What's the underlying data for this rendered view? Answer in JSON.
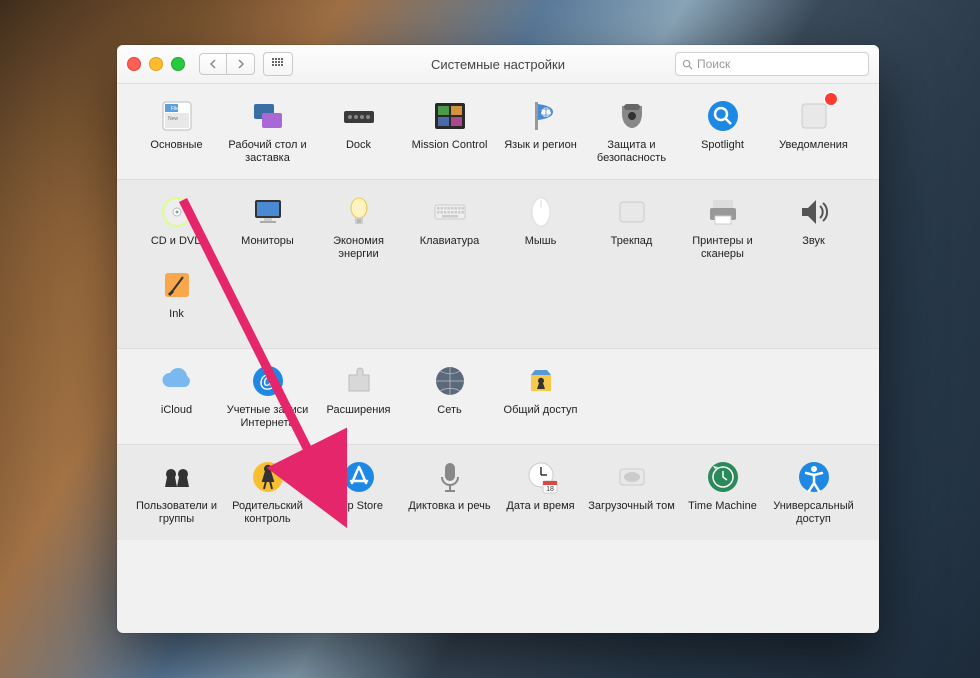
{
  "window": {
    "title": "Системные настройки",
    "search_placeholder": "Поиск"
  },
  "sections": [
    {
      "alt": false,
      "items": [
        {
          "id": "general",
          "label": "Основные"
        },
        {
          "id": "desktop",
          "label": "Рабочий стол и заставка"
        },
        {
          "id": "dock",
          "label": "Dock"
        },
        {
          "id": "mission",
          "label": "Mission Control"
        },
        {
          "id": "language",
          "label": "Язык и регион"
        },
        {
          "id": "security",
          "label": "Защита и безопасность"
        },
        {
          "id": "spotlight",
          "label": "Spotlight"
        },
        {
          "id": "notifications",
          "label": "Уведомления",
          "badge": true
        }
      ]
    },
    {
      "alt": true,
      "items": [
        {
          "id": "cddvd",
          "label": "CD и DVD"
        },
        {
          "id": "displays",
          "label": "Мониторы"
        },
        {
          "id": "energy",
          "label": "Экономия энергии"
        },
        {
          "id": "keyboard",
          "label": "Клавиатура"
        },
        {
          "id": "mouse",
          "label": "Мышь"
        },
        {
          "id": "trackpad",
          "label": "Трекпад"
        },
        {
          "id": "printers",
          "label": "Принтеры и сканеры"
        },
        {
          "id": "sound",
          "label": "Звук"
        },
        {
          "id": "ink",
          "label": "Ink"
        }
      ]
    },
    {
      "alt": false,
      "items": [
        {
          "id": "icloud",
          "label": "iCloud"
        },
        {
          "id": "internet",
          "label": "Учетные записи Интернета"
        },
        {
          "id": "extensions",
          "label": "Расширения"
        },
        {
          "id": "network",
          "label": "Сеть"
        },
        {
          "id": "sharing",
          "label": "Общий доступ"
        }
      ]
    },
    {
      "alt": true,
      "items": [
        {
          "id": "users",
          "label": "Пользователи и группы"
        },
        {
          "id": "parental",
          "label": "Родительский контроль"
        },
        {
          "id": "appstore",
          "label": "App Store"
        },
        {
          "id": "dictation",
          "label": "Диктовка и речь"
        },
        {
          "id": "datetime",
          "label": "Дата и время"
        },
        {
          "id": "startup",
          "label": "Загрузочный том"
        },
        {
          "id": "timemachine",
          "label": "Time Machine"
        },
        {
          "id": "accessibility",
          "label": "Универсальный доступ"
        }
      ]
    }
  ],
  "annotation": {
    "arrow_target": "appstore",
    "arrow_color": "#e6266b"
  }
}
